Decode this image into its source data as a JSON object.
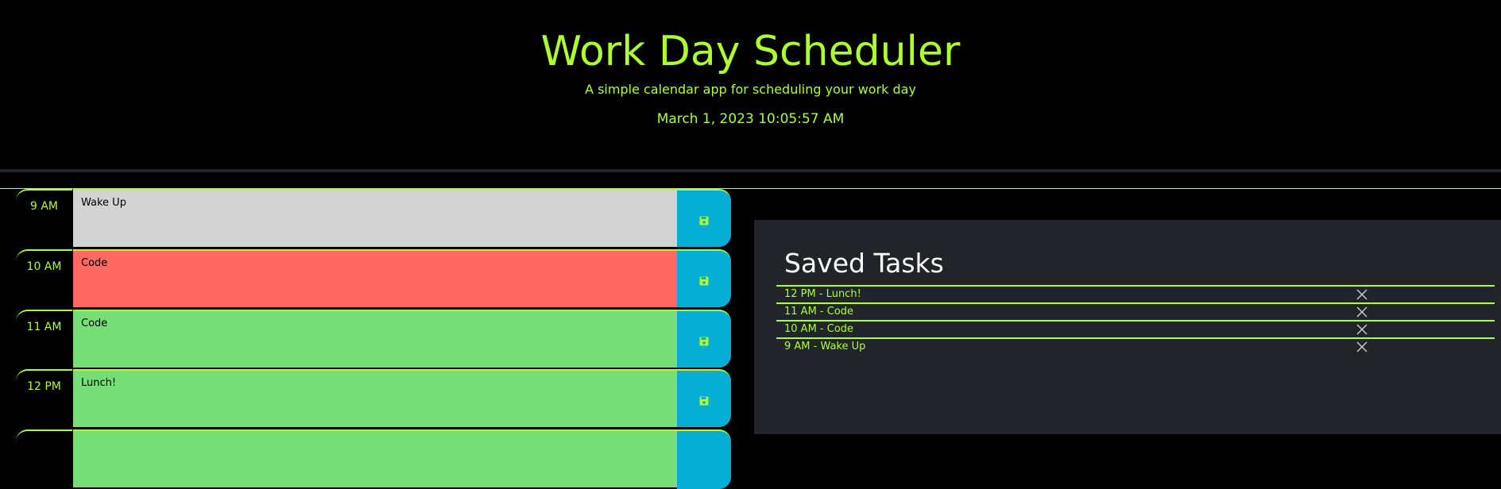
{
  "header": {
    "title": "Work Day Scheduler",
    "subtitle": "A simple calendar app for scheduling your work day",
    "current_date": "March 1, 2023 10:05:57 AM"
  },
  "colors": {
    "accent": "#adff2f",
    "past": "#d3d3d3",
    "present": "#ff6961",
    "future": "#77dd77",
    "save_button": "#06aed5",
    "panel_bg": "#212529"
  },
  "timeblocks": [
    {
      "hour": "9 AM",
      "text": "Wake Up",
      "state": "past",
      "save_icon": "save-icon"
    },
    {
      "hour": "10 AM",
      "text": "Code",
      "state": "present",
      "save_icon": "save-icon"
    },
    {
      "hour": "11 AM",
      "text": "Code",
      "state": "future",
      "save_icon": "save-icon"
    },
    {
      "hour": "12 PM",
      "text": "Lunch!",
      "state": "future",
      "save_icon": "save-icon"
    }
  ],
  "saved_tasks": {
    "title": "Saved Tasks",
    "items": [
      {
        "label": "12 PM - Lunch!",
        "delete_icon": "close-icon"
      },
      {
        "label": "11 AM - Code",
        "delete_icon": "close-icon"
      },
      {
        "label": "10 AM - Code",
        "delete_icon": "close-icon"
      },
      {
        "label": "9 AM - Wake Up",
        "delete_icon": "close-icon"
      }
    ]
  }
}
